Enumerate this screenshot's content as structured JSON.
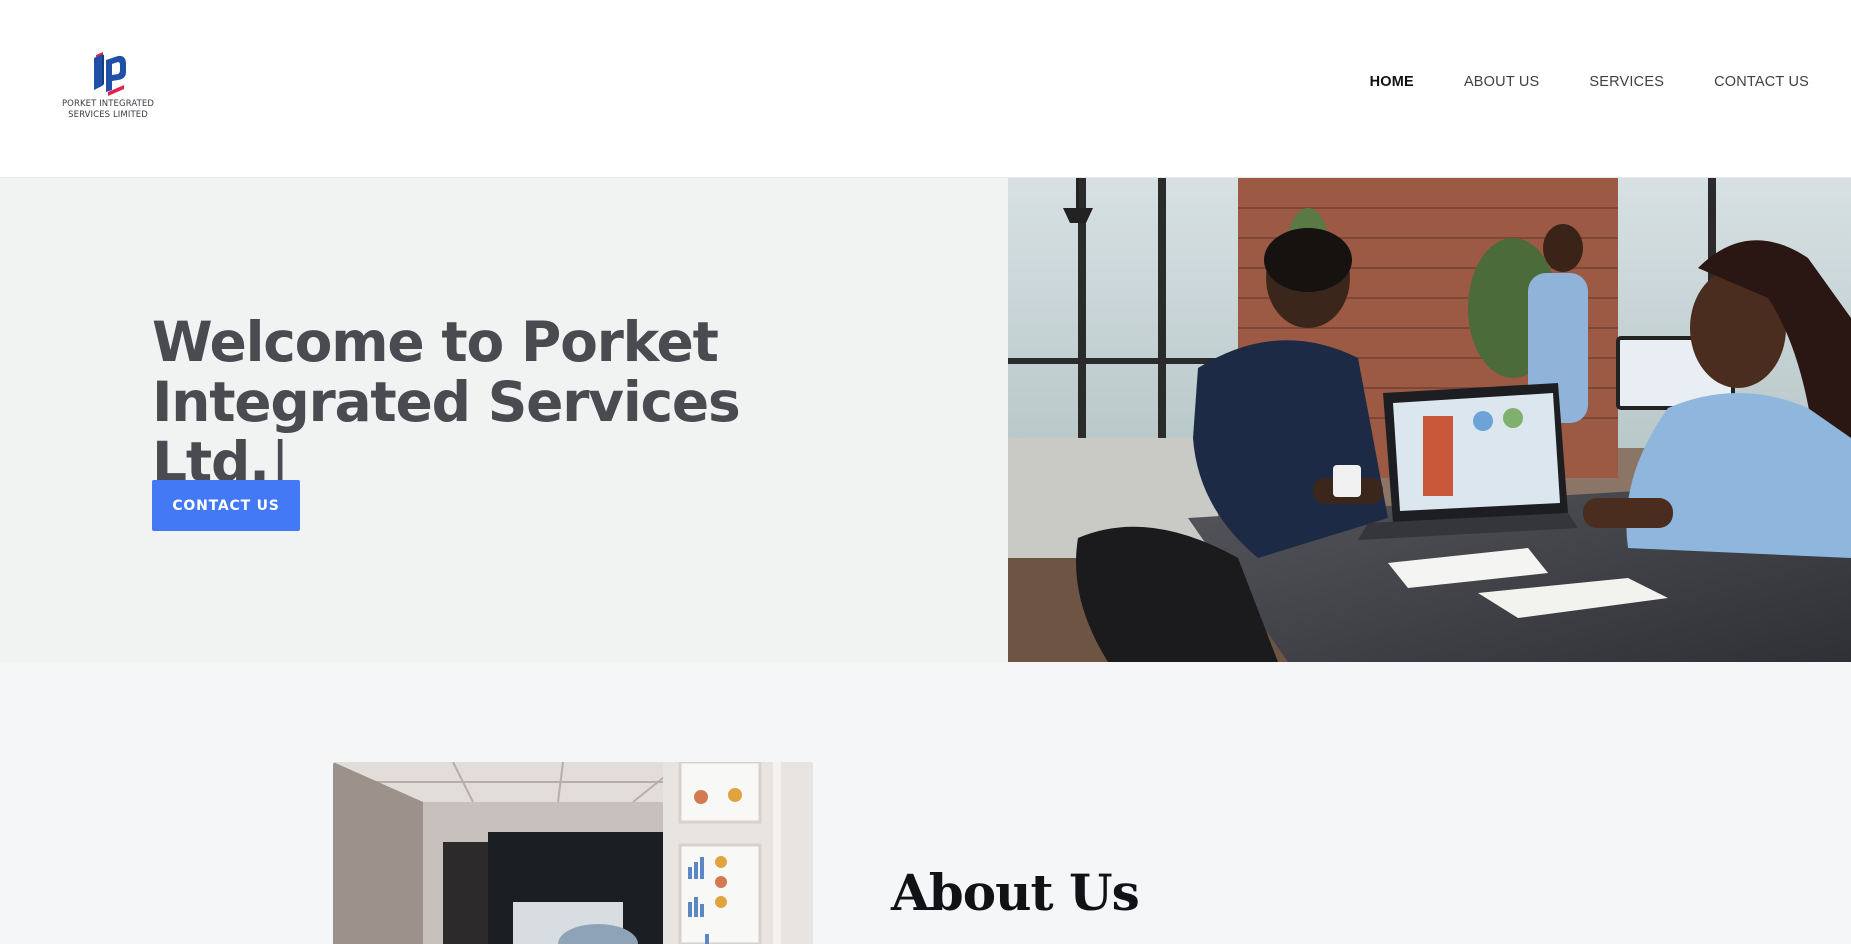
{
  "header": {
    "logo_text_line1": "PORKET INTEGRATED",
    "logo_text_line2": "SERVICES LIMITED",
    "nav": [
      {
        "label": "HOME",
        "active": true
      },
      {
        "label": "ABOUT US",
        "active": false
      },
      {
        "label": "SERVICES",
        "active": false
      },
      {
        "label": "CONTACT US",
        "active": false
      }
    ]
  },
  "hero": {
    "title_line1": "Welcome to Porket",
    "title_line2": "Integrated Services Ltd.",
    "caret": "|",
    "button_label": "CONTACT US"
  },
  "about": {
    "title": "About Us"
  },
  "colors": {
    "accent": "#4479f5",
    "logo_blue": "#1f4fa8",
    "logo_red": "#e0234e",
    "hero_bg": "#f1f2f2",
    "page_bg": "#f5f6f8"
  }
}
